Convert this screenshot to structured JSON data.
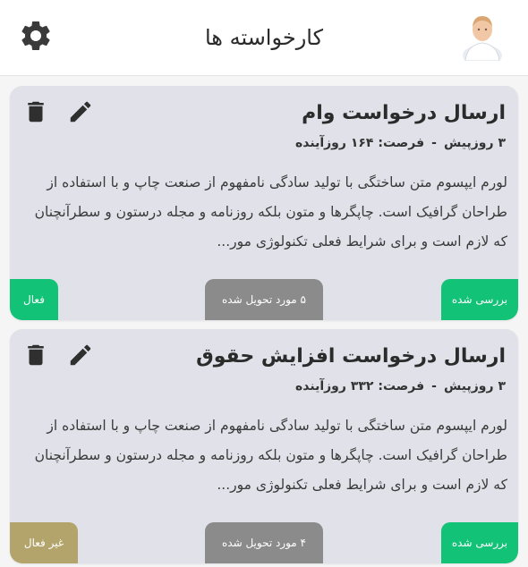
{
  "header": {
    "title": "کارخواسته ها"
  },
  "cards": [
    {
      "title": "ارسال درخواست وام",
      "age": "۳ روزپیش",
      "separator": "-",
      "deadline": "فرصت: ۱۶۴ روزآینده",
      "description": "لورم ایپسوم متن ساختگی با تولید سادگی نامفهوم از صنعت چاپ و با استفاده از طراحان گرافیک است. چاپگرها و متون بلکه روزنامه و مجله درستون و سطرآنچنان که لازم است و برای شرایط فعلی تکنولوژی مور...",
      "review_status": "بررسی شده",
      "delivered": "۵ مورد تحویل شده",
      "state": "فعال"
    },
    {
      "title": "ارسال درخواست افزایش حقوق",
      "age": "۳ روزپیش",
      "separator": "-",
      "deadline": "فرصت: ۳۳۲ روزآینده",
      "description": "لورم ایپسوم متن ساختگی با تولید سادگی نامفهوم از صنعت چاپ و با استفاده از طراحان گرافیک است. چاپگرها و متون بلکه روزنامه و مجله درستون و سطرآنچنان که لازم است و برای شرایط فعلی تکنولوژی مور...",
      "review_status": "بررسی شده",
      "delivered": "۴ مورد تحویل شده",
      "state": "غیر فعال"
    }
  ],
  "icons": {
    "settings": "gear-icon",
    "avatar": "user-avatar",
    "edit": "pencil-icon",
    "delete": "trash-icon"
  },
  "colors": {
    "green": "#12c277",
    "gray": "#8b8b8b",
    "khaki": "#b2a46a",
    "card_bg": "#e1e2e9"
  }
}
